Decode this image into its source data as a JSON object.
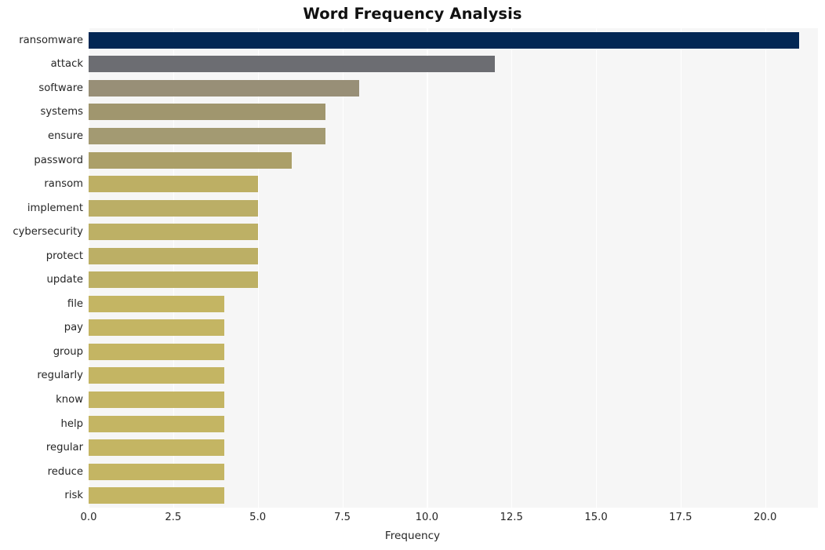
{
  "chart_data": {
    "type": "bar",
    "orientation": "horizontal",
    "title": "Word Frequency Analysis",
    "xlabel": "Frequency",
    "ylabel": "",
    "categories": [
      "ransomware",
      "attack",
      "software",
      "systems",
      "ensure",
      "password",
      "ransom",
      "implement",
      "cybersecurity",
      "protect",
      "update",
      "file",
      "pay",
      "group",
      "regularly",
      "know",
      "help",
      "regular",
      "reduce",
      "risk"
    ],
    "values": [
      21,
      12,
      8,
      7,
      7,
      6,
      5,
      5,
      5,
      5,
      5,
      4,
      4,
      4,
      4,
      4,
      4,
      4,
      4,
      4
    ],
    "bar_colors": [
      "#032754",
      "#6c6d72",
      "#988f77",
      "#a0966e",
      "#a39a72",
      "#ab9f68",
      "#bdaf64",
      "#bbae66",
      "#bdb065",
      "#bcaf65",
      "#bdb064",
      "#c4b563",
      "#c4b563",
      "#c4b563",
      "#c4b563",
      "#c4b563",
      "#c4b563",
      "#c4b563",
      "#c4b563",
      "#c4b563"
    ],
    "xticks": [
      0.0,
      2.5,
      5.0,
      7.5,
      10.0,
      12.5,
      15.0,
      17.5,
      20.0
    ],
    "xtick_labels": [
      "0.0",
      "2.5",
      "5.0",
      "7.5",
      "10.0",
      "12.5",
      "15.0",
      "17.5",
      "20.0"
    ],
    "xlim": [
      0,
      21.56
    ],
    "grid": true,
    "grid_axis": "x",
    "grid_color": "#ffffff",
    "plot_background": "#f6f6f6",
    "figure_background": "#ffffff",
    "legend": null
  }
}
